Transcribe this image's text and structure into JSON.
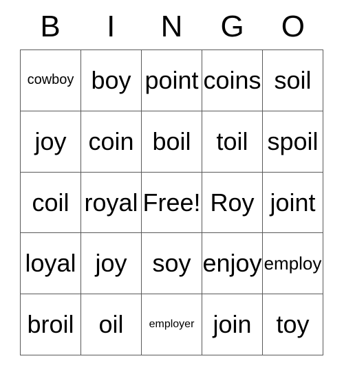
{
  "card": {
    "title": "BINGO",
    "columns": [
      "B",
      "I",
      "N",
      "G",
      "O"
    ],
    "free_space_label": "Free!",
    "grid": [
      [
        {
          "text": "cowboy",
          "size": "sm"
        },
        {
          "text": "boy",
          "size": "lg"
        },
        {
          "text": "point",
          "size": "lg"
        },
        {
          "text": "coins",
          "size": "lg"
        },
        {
          "text": "soil",
          "size": "lg"
        }
      ],
      [
        {
          "text": "joy",
          "size": "lg"
        },
        {
          "text": "coin",
          "size": "lg"
        },
        {
          "text": "boil",
          "size": "lg"
        },
        {
          "text": "toil",
          "size": "lg"
        },
        {
          "text": "spoil",
          "size": "lg"
        }
      ],
      [
        {
          "text": "coil",
          "size": "lg"
        },
        {
          "text": "royal",
          "size": "lg"
        },
        {
          "text": "Free!",
          "size": "lg"
        },
        {
          "text": "Roy",
          "size": "lg"
        },
        {
          "text": "joint",
          "size": "lg"
        }
      ],
      [
        {
          "text": "loyal",
          "size": "lg"
        },
        {
          "text": "joy",
          "size": "lg"
        },
        {
          "text": "soy",
          "size": "lg"
        },
        {
          "text": "enjoy",
          "size": "lg"
        },
        {
          "text": "employ",
          "size": "md"
        }
      ],
      [
        {
          "text": "broil",
          "size": "lg"
        },
        {
          "text": "oil",
          "size": "lg"
        },
        {
          "text": "employer",
          "size": "xs"
        },
        {
          "text": "join",
          "size": "lg"
        },
        {
          "text": "toy",
          "size": "lg"
        }
      ]
    ]
  },
  "colors": {
    "background": "#ffffff",
    "text": "#000000",
    "grid_line": "#595959"
  }
}
